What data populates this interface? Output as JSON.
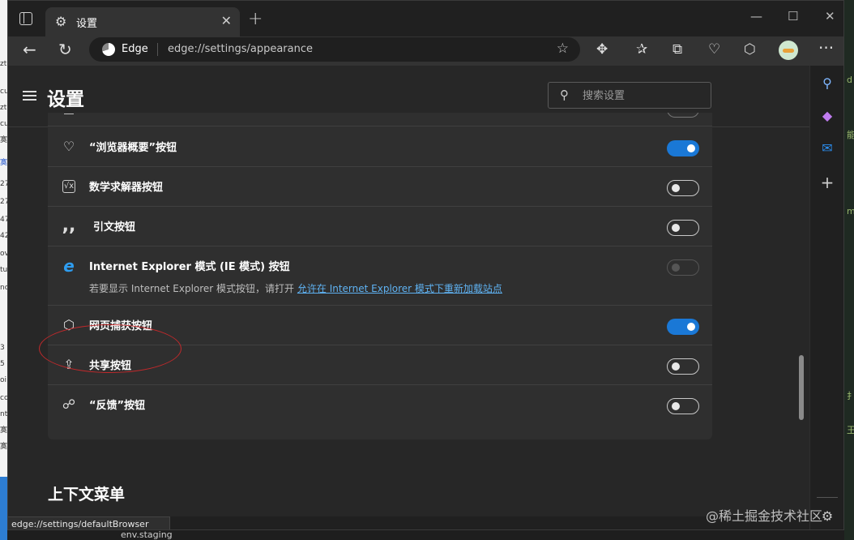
{
  "browser": {
    "tab_title": "设置",
    "brand_label": "Edge",
    "url": "edge://settings/appearance"
  },
  "settings": {
    "page_title": "设置",
    "search_placeholder": "搜索设置",
    "rows": [
      {
        "id": "browser-essentials",
        "icon": "heartbeat-icon",
        "label": "“浏览器概要”按钮",
        "state": "on"
      },
      {
        "id": "math-solver",
        "icon": "math-solver-icon",
        "label": "数学求解器按钮",
        "state": "off"
      },
      {
        "id": "citation",
        "icon": "quote-icon",
        "label": "引文按钮",
        "state": "off"
      },
      {
        "id": "ie-mode",
        "icon": "internet-explorer-icon",
        "label": "Internet Explorer 模式 (IE 模式) 按钮",
        "state": "disabled",
        "description": "若要显示 Internet Explorer 模式按钮，请打开 ",
        "link": "允许在 Internet Explorer 模式下重新加载站点"
      },
      {
        "id": "web-capture",
        "icon": "web-capture-icon",
        "label": "网页捕获按钮",
        "state": "on"
      },
      {
        "id": "share",
        "icon": "share-icon",
        "label": "共享按钮",
        "state": "off"
      },
      {
        "id": "feedback",
        "icon": "feedback-icon",
        "label": "“反馈”按钮",
        "state": "off"
      }
    ],
    "next_section_title": "上下文菜单"
  },
  "status_bar": {
    "text": "edge://settings/defaultBrowser"
  },
  "watermark": "@稀土掘金技术社区",
  "background": {
    "bottom_text": "env.staging",
    "left_chars": [
      "zt",
      "cu",
      "寞",
      "zt",
      "cu",
      "寞",
      "27",
      "27",
      "47",
      "42",
      "ov",
      "tu",
      "no",
      "3",
      "5",
      "oi",
      "co",
      "nt",
      "寞",
      "寞"
    ],
    "right_chars": [
      "d",
      "能",
      "m",
      "扌",
      "王"
    ]
  },
  "colors": {
    "accent": "#1a78d6",
    "link": "#5fb2f2",
    "annotation": "#c0292b"
  }
}
